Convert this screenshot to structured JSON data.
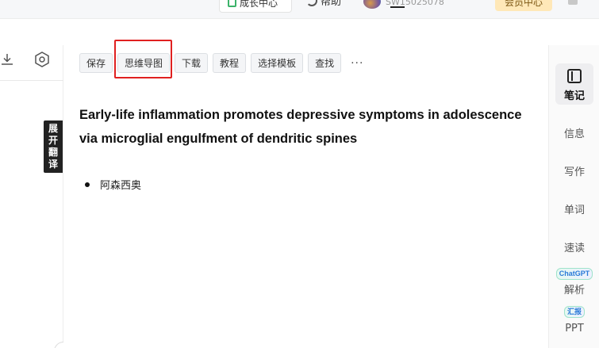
{
  "topbar": {
    "growth_center": "成长中心",
    "help": "帮助",
    "username": "SW15025078",
    "member_center": "会员中心"
  },
  "left_panel": {
    "expand_translate": [
      "展",
      "开",
      "翻",
      "译"
    ]
  },
  "toolbar": {
    "save": "保存",
    "mindmap": "思维导图",
    "download": "下载",
    "tutorial": "教程",
    "choose_template": "选择模板",
    "find": "查找",
    "more": "···"
  },
  "document": {
    "title_line1": "Early-life inflammation promotes depressive symptoms in adolescence",
    "title_line2": "via microglial engulfment of dendritic spines",
    "bullets": [
      "阿森西奥"
    ]
  },
  "right_sidebar": {
    "notes": "笔记",
    "info": "信息",
    "write": "写作",
    "words": "单词",
    "speed_read": "速读",
    "chatgpt_badge": "ChatGPT",
    "analyze": "解析",
    "report_badge": "汇报",
    "ppt": "PPT"
  },
  "colors": {
    "highlight": "#e02020",
    "accent_green": "#3cb36a",
    "member_bg": "#ffe8b8"
  }
}
